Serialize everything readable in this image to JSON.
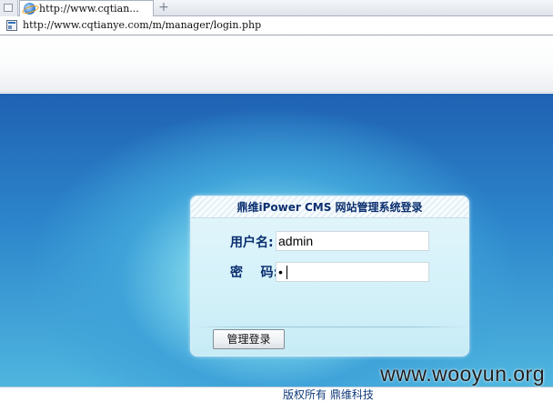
{
  "browser": {
    "tab_title": "http://www.cqtian...",
    "new_tab_symbol": "+",
    "address_url": "http://www.cqtianye.com/m/manager/login.php"
  },
  "login": {
    "title": "鼎维iPower CMS 网站管理系统登录",
    "username_label": "用户名:",
    "username_value": "admin",
    "password_label": "密    码:",
    "password_value": "•",
    "submit_label": "管理登录"
  },
  "footer": {
    "copyright": "版权所有  鼎维科技"
  },
  "watermark": "www.wooyun.org",
  "colors": {
    "page_blue": "#2d86cb",
    "panel_bg": "#d3f1f9",
    "label_navy": "#0b2f6f"
  }
}
